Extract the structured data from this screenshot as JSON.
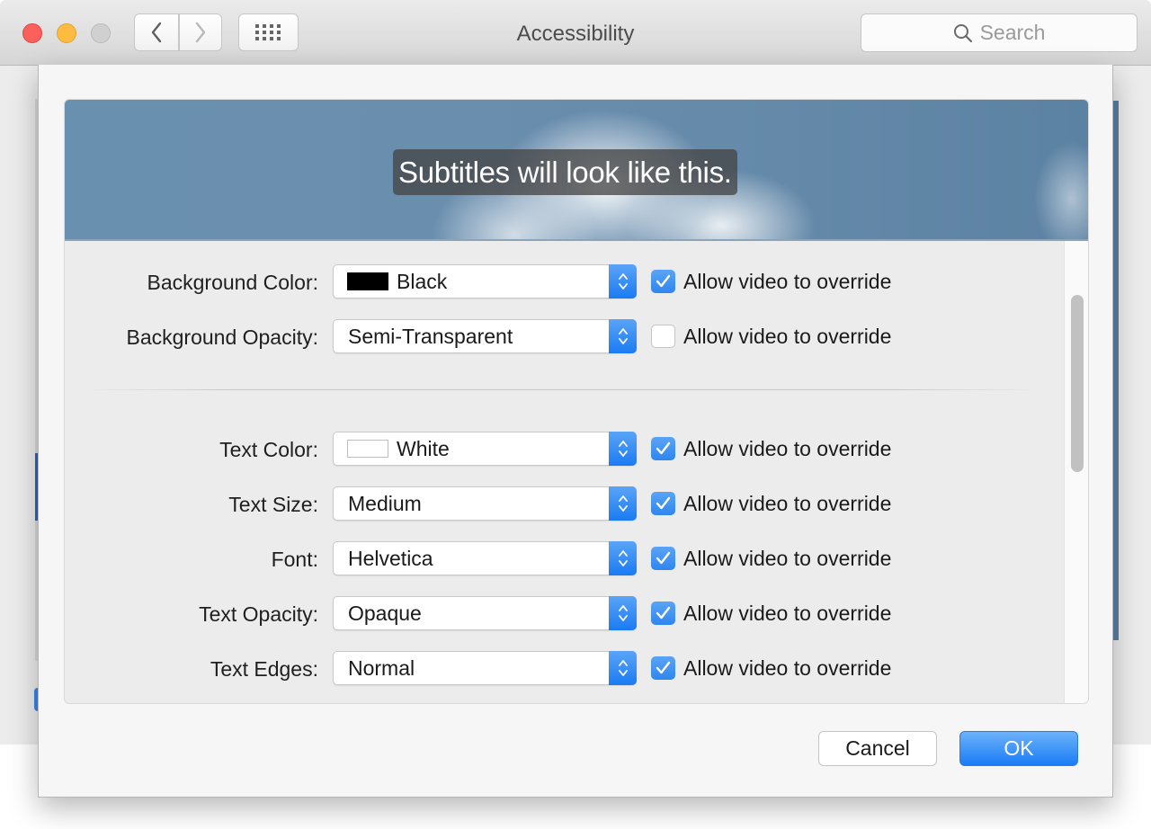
{
  "window": {
    "title": "Accessibility",
    "search_placeholder": "Search",
    "icons": {
      "close": "close-button",
      "minimize": "minimize-button",
      "zoom": "zoom-button-disabled",
      "back": "chevron-left-icon",
      "forward": "chevron-right-icon",
      "show_all": "grid-icon",
      "search": "magnifier-icon"
    }
  },
  "sheet": {
    "preview_text": "Subtitles will look like this.",
    "rows": [
      {
        "label": "Background Color:",
        "value": "Black",
        "swatch": "#000000",
        "override_label": "Allow video to override",
        "override": true
      },
      {
        "label": "Background Opacity:",
        "value": "Semi-Transparent",
        "swatch": null,
        "override_label": "Allow video to override",
        "override": false
      },
      {
        "label": "Text Color:",
        "value": "White",
        "swatch": "#ffffff",
        "override_label": "Allow video to override",
        "override": true
      },
      {
        "label": "Text Size:",
        "value": "Medium",
        "swatch": null,
        "override_label": "Allow video to override",
        "override": true
      },
      {
        "label": "Font:",
        "value": "Helvetica",
        "swatch": null,
        "override_label": "Allow video to override",
        "override": true
      },
      {
        "label": "Text Opacity:",
        "value": "Opaque",
        "swatch": null,
        "override_label": "Allow video to override",
        "override": true
      },
      {
        "label": "Text Edges:",
        "value": "Normal",
        "swatch": null,
        "override_label": "Allow video to override",
        "override": true
      }
    ],
    "cancel_label": "Cancel",
    "ok_label": "OK"
  },
  "colors": {
    "accent": "#1a7cf5",
    "checkbox_on": "#3a8ef0"
  }
}
